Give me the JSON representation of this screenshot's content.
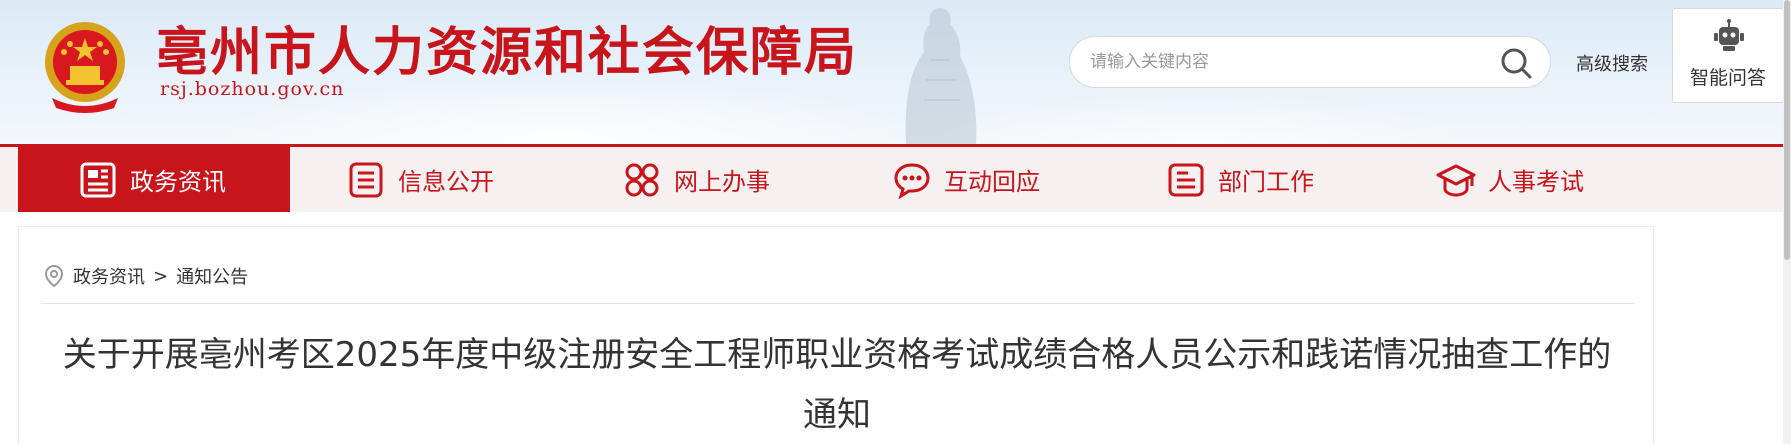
{
  "header": {
    "site_title": "亳州市人力资源和社会保障局",
    "site_domain": "rsj.bozhou.gov.cn",
    "search_placeholder": "请输入关键内容",
    "advanced_search": "高级搜索",
    "ai_qa": "智能问答"
  },
  "nav": {
    "items": [
      {
        "label": "政务资讯",
        "icon": "news-icon",
        "active": true
      },
      {
        "label": "信息公开",
        "icon": "list-doc-icon",
        "active": false
      },
      {
        "label": "网上办事",
        "icon": "grid-rings-icon",
        "active": false
      },
      {
        "label": "互动回应",
        "icon": "chat-bubble-icon",
        "active": false
      },
      {
        "label": "部门工作",
        "icon": "folder-doc-icon",
        "active": false
      },
      {
        "label": "人事考试",
        "icon": "graduation-cap-icon",
        "active": false
      }
    ]
  },
  "breadcrumb": {
    "level1": "政务资讯",
    "separator": ">",
    "level2": "通知公告"
  },
  "article": {
    "title": "关于开展亳州考区2025年度中级注册安全工程师职业资格考试成绩合格人员公示和践诺情况抽查工作的通知"
  },
  "colors": {
    "brand_red": "#c8141b",
    "nav_bg": "#f7f0f1"
  }
}
